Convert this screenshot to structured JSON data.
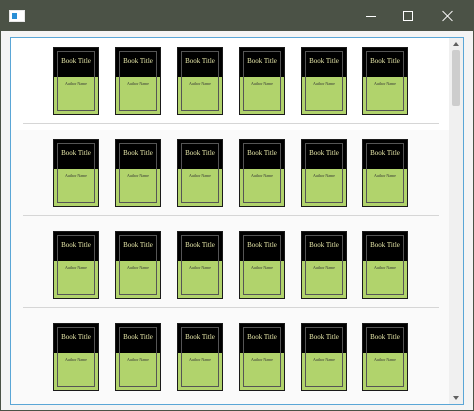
{
  "window": {
    "title": ""
  },
  "books": {
    "rows": [
      [
        {
          "title": "Book Title",
          "author": "Author Name"
        },
        {
          "title": "Book Title",
          "author": "Author Name"
        },
        {
          "title": "Book Title",
          "author": "Author Name"
        },
        {
          "title": "Book Title",
          "author": "Author Name"
        },
        {
          "title": "Book Title",
          "author": "Author Name"
        },
        {
          "title": "Book Title",
          "author": "Author Name"
        }
      ],
      [
        {
          "title": "Book Title",
          "author": "Author Name"
        },
        {
          "title": "Book Title",
          "author": "Author Name"
        },
        {
          "title": "Book Title",
          "author": "Author Name"
        },
        {
          "title": "Book Title",
          "author": "Author Name"
        },
        {
          "title": "Book Title",
          "author": "Author Name"
        },
        {
          "title": "Book Title",
          "author": "Author Name"
        }
      ],
      [
        {
          "title": "Book Title",
          "author": "Author Name"
        },
        {
          "title": "Book Title",
          "author": "Author Name"
        },
        {
          "title": "Book Title",
          "author": "Author Name"
        },
        {
          "title": "Book Title",
          "author": "Author Name"
        },
        {
          "title": "Book Title",
          "author": "Author Name"
        },
        {
          "title": "Book Title",
          "author": "Author Name"
        }
      ],
      [
        {
          "title": "Book Title",
          "author": "Author Name"
        },
        {
          "title": "Book Title",
          "author": "Author Name"
        },
        {
          "title": "Book Title",
          "author": "Author Name"
        },
        {
          "title": "Book Title",
          "author": "Author Name"
        },
        {
          "title": "Book Title",
          "author": "Author Name"
        },
        {
          "title": "Book Title",
          "author": "Author Name"
        }
      ]
    ]
  },
  "colors": {
    "titlebar": "#4b5246",
    "cover_top": "#000000",
    "cover_bottom": "#b1d36c",
    "title_text": "#e6e6a8",
    "client_border": "#5aa6d6"
  },
  "icons": {
    "app": "app-window-icon",
    "minimize": "minimize-icon",
    "maximize": "maximize-icon",
    "close": "close-icon",
    "scroll_up": "scroll-up-arrow-icon",
    "scroll_down": "scroll-down-arrow-icon"
  }
}
